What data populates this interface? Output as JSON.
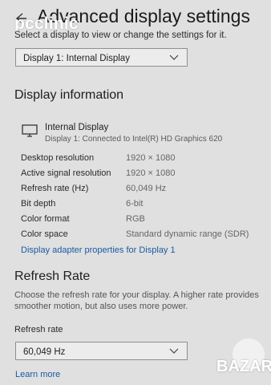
{
  "watermark": "pcclinic",
  "header": {
    "title": "Advanced display settings",
    "subtitle": "Select a display to view or change the settings for it."
  },
  "display_select": {
    "value": "Display 1: Internal Display"
  },
  "display_info": {
    "heading": "Display information",
    "name": "Internal Display",
    "connection": "Display 1: Connected to Intel(R) HD Graphics 620",
    "rows": [
      {
        "label": "Desktop resolution",
        "value": "1920 × 1080"
      },
      {
        "label": "Active signal resolution",
        "value": "1920 × 1080"
      },
      {
        "label": "Refresh rate (Hz)",
        "value": "60,049 Hz"
      },
      {
        "label": "Bit depth",
        "value": "6-bit"
      },
      {
        "label": "Color format",
        "value": "RGB"
      },
      {
        "label": "Color space",
        "value": "Standard dynamic range (SDR)"
      }
    ],
    "adapter_link": "Display adapter properties for Display 1"
  },
  "refresh": {
    "heading": "Refresh Rate",
    "description": "Choose the refresh rate for your display. A higher rate provides smoother motion, but also uses more power.",
    "field_label": "Refresh rate",
    "value": "60,049 Hz"
  },
  "learn_more": "Learn more",
  "badge": "BAZAR",
  "icons": {
    "back": "back-arrow-icon",
    "monitor": "monitor-icon",
    "chevron": "chevron-down-icon"
  },
  "colors": {
    "link": "#1d5aa6",
    "background": "#dfe0df"
  }
}
